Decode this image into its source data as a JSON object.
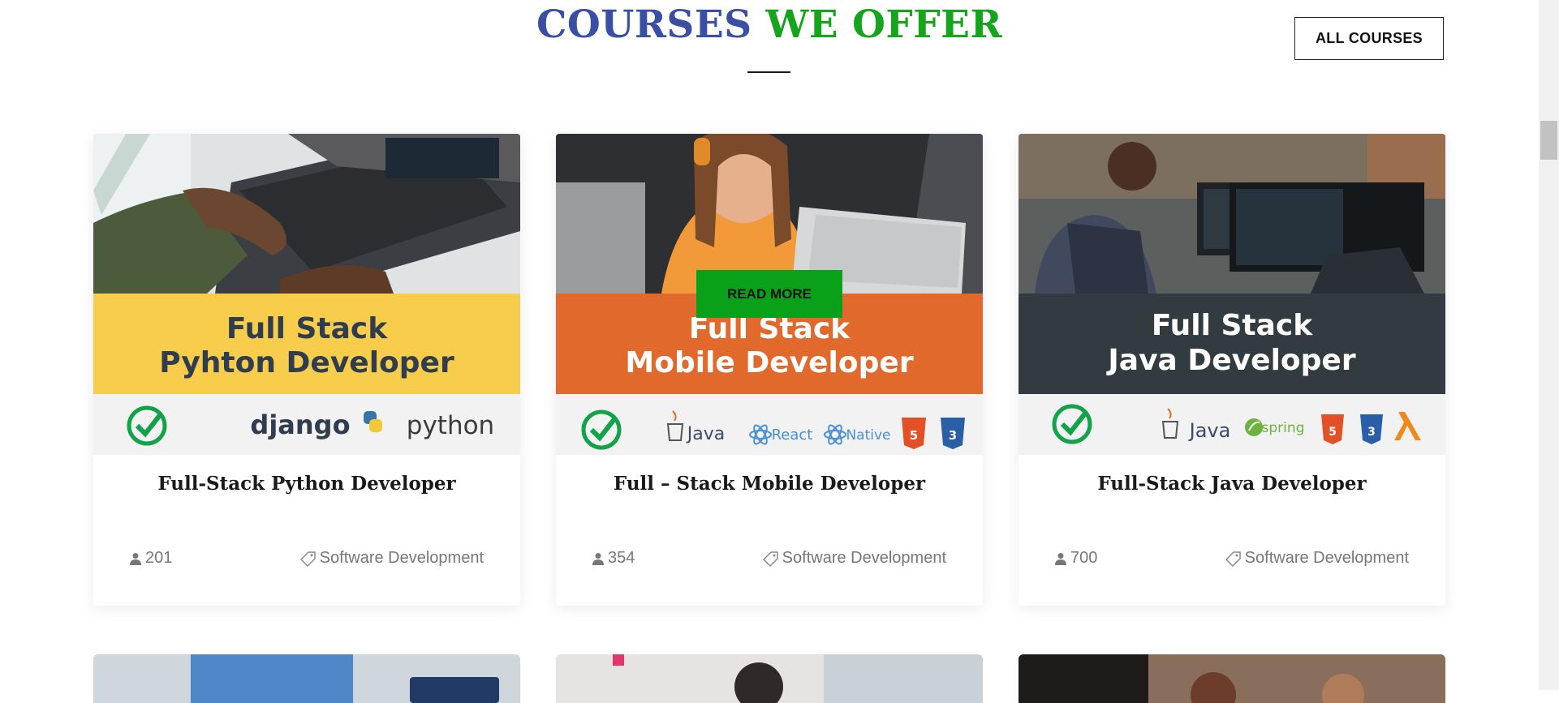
{
  "section": {
    "heading_part1": "COURSES",
    "heading_part2": "WE OFFER",
    "all_courses_label": "ALL COURSES"
  },
  "courses": [
    {
      "title": "Full-Stack Python Developer",
      "students": "201",
      "category": "Software Development",
      "banner_line1": "Full Stack",
      "banner_line2": "Pyhton Developer",
      "logos": [
        "django",
        "python"
      ]
    },
    {
      "title": "Full – Stack Mobile Developer",
      "students": "354",
      "category": "Software Development",
      "banner_line1": "Full Stack",
      "banner_line2": "Mobile Developer",
      "logos": [
        "Java",
        "React",
        "Native"
      ],
      "hover_button": "READ MORE"
    },
    {
      "title": "Full-Stack Java Developer",
      "students": "700",
      "category": "Software Development",
      "banner_line1": "Full Stack",
      "banner_line2": "Java Developer",
      "logos": [
        "Java",
        "spring"
      ]
    }
  ],
  "colors": {
    "heading_blue": "#3a4fa4",
    "heading_green": "#16a41c",
    "read_more_green": "#0aa01a",
    "python_banner": "#f7cd4b",
    "mobile_banner": "#e2692c",
    "java_banner": "#323b40"
  },
  "icons": [
    "user-icon",
    "tag-icon",
    "check-badge-icon",
    "python-logo-icon",
    "java-cup-icon",
    "react-atom-icon",
    "html5-icon",
    "css3-icon",
    "spring-leaf-icon",
    "lambda-icon"
  ]
}
